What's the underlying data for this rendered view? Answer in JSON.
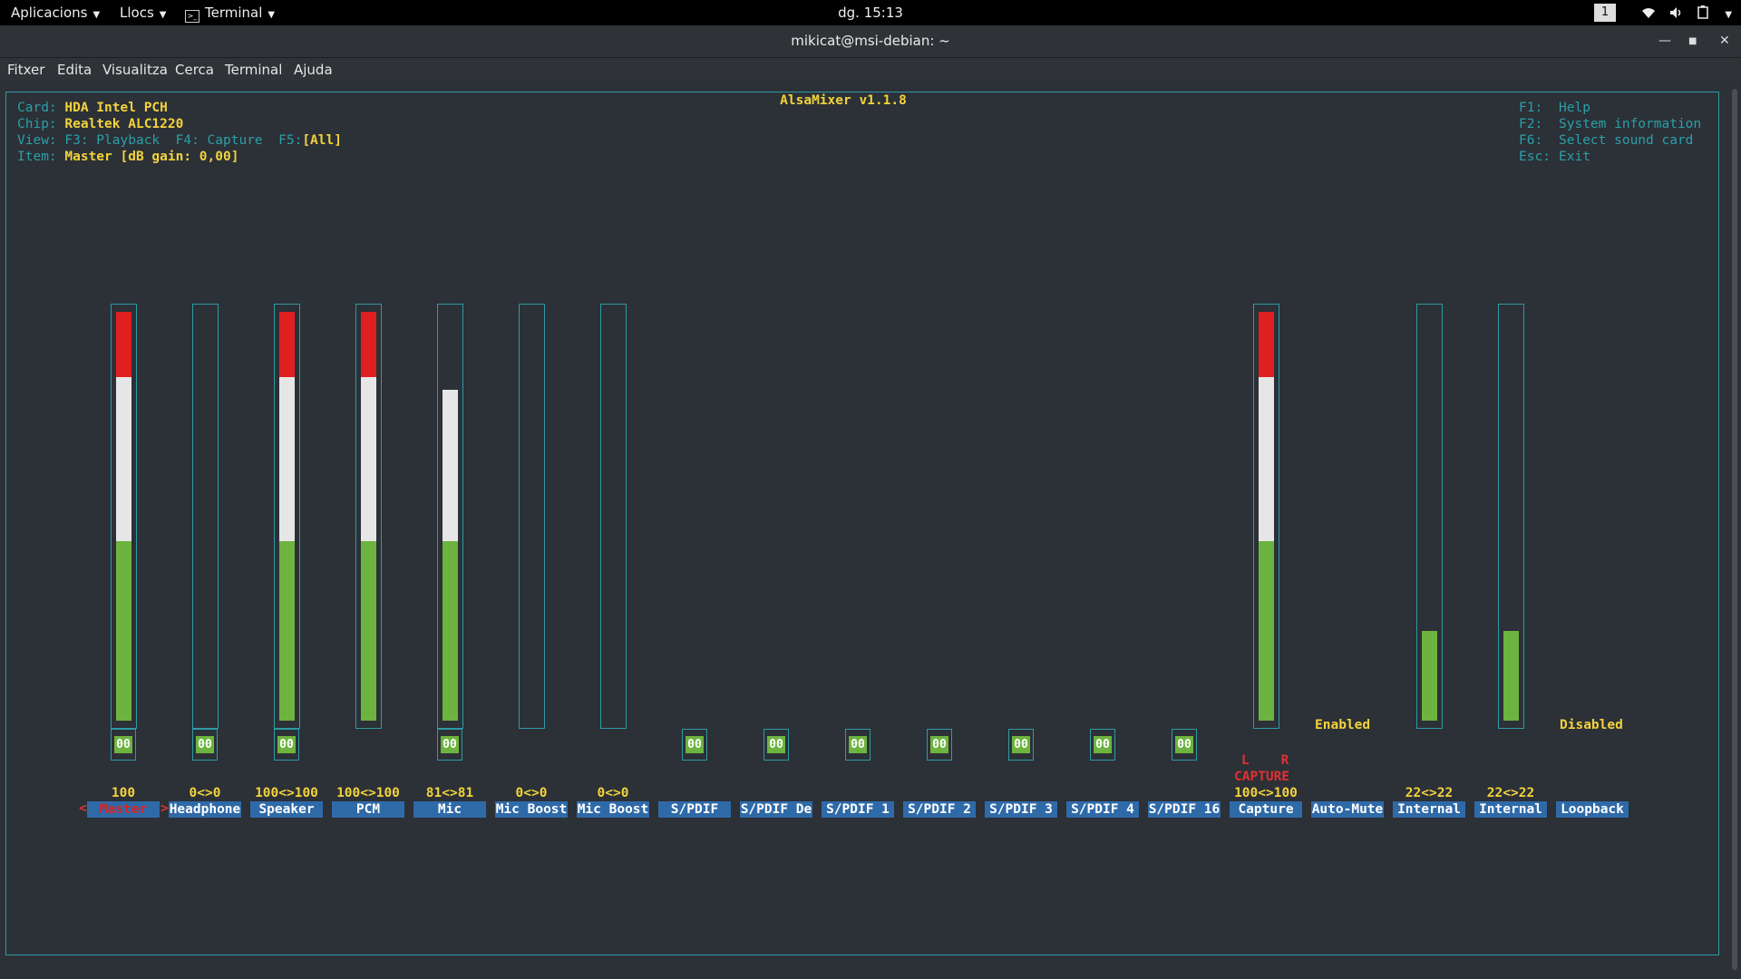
{
  "topbar": {
    "apps": "Aplicacions",
    "places": "Llocs",
    "terminal": "Terminal",
    "clock": "dg. 15:13",
    "workspace": "1"
  },
  "window": {
    "title": "mikicat@msi-debian: ~",
    "menu": [
      "Fitxer",
      "Edita",
      "Visualitza",
      "Cerca",
      "Terminal",
      "Ajuda"
    ]
  },
  "alsamixer": {
    "title": "AlsaMixer v1.1.8",
    "card_label": "Card:",
    "card": "HDA Intel PCH",
    "chip_label": "Chip:",
    "chip": "Realtek ALC1220",
    "view_label": "View:",
    "view_f3": "F3: Playback",
    "view_f4": "F4: Capture",
    "view_f5": "F5:",
    "view_all": "[All]",
    "item_label": "Item:",
    "item": "Master [dB gain: 0,00]",
    "help": [
      {
        "key": "F1:",
        "text": "Help"
      },
      {
        "key": "F2:",
        "text": "System information"
      },
      {
        "key": "F6:",
        "text": "Select sound card"
      },
      {
        "key": "Esc:",
        "text": "Exit"
      }
    ],
    "channels": [
      {
        "name": "Master",
        "value": "100",
        "level": 100,
        "mute": "00",
        "selected": true
      },
      {
        "name": "Headphone",
        "value": "0<>0",
        "level": 0,
        "mute": "00"
      },
      {
        "name": "Speaker",
        "value": "100<>100",
        "level": 100,
        "mute": "00"
      },
      {
        "name": "PCM",
        "value": "100<>100",
        "level": 100
      },
      {
        "name": "Mic",
        "value": "81<>81",
        "level": 81,
        "mute": "00"
      },
      {
        "name": "Mic Boost",
        "value": "0<>0",
        "level": 0
      },
      {
        "name": "Mic Boost",
        "value": "0<>0",
        "level": 0
      },
      {
        "name": "S/PDIF",
        "mute": "00"
      },
      {
        "name": "S/PDIF De",
        "mute": "00"
      },
      {
        "name": "S/PDIF 1",
        "mute": "00"
      },
      {
        "name": "S/PDIF 2",
        "mute": "00"
      },
      {
        "name": "S/PDIF 3",
        "mute": "00"
      },
      {
        "name": "S/PDIF 4",
        "mute": "00"
      },
      {
        "name": "S/PDIF 16",
        "mute": "00"
      },
      {
        "name": "Capture",
        "value": "100<>100",
        "level": 100,
        "capture_lr": "L    R",
        "capture_label": "CAPTURE"
      },
      {
        "name": "Auto-Mute",
        "state": "Enabled"
      },
      {
        "name": "Internal",
        "value": "22<>22",
        "level": 22
      },
      {
        "name": "Internal",
        "value": "22<>22",
        "level": 22
      },
      {
        "name": "Loopback",
        "state": "Disabled"
      }
    ],
    "selection_left": "<",
    "selection_right": ">"
  },
  "colors": {
    "level_green": "#6db33f",
    "level_white": "#e6e6e6",
    "level_red": "#e02020",
    "frame": "#2d9ba4",
    "highlight": "#f2d33b"
  }
}
